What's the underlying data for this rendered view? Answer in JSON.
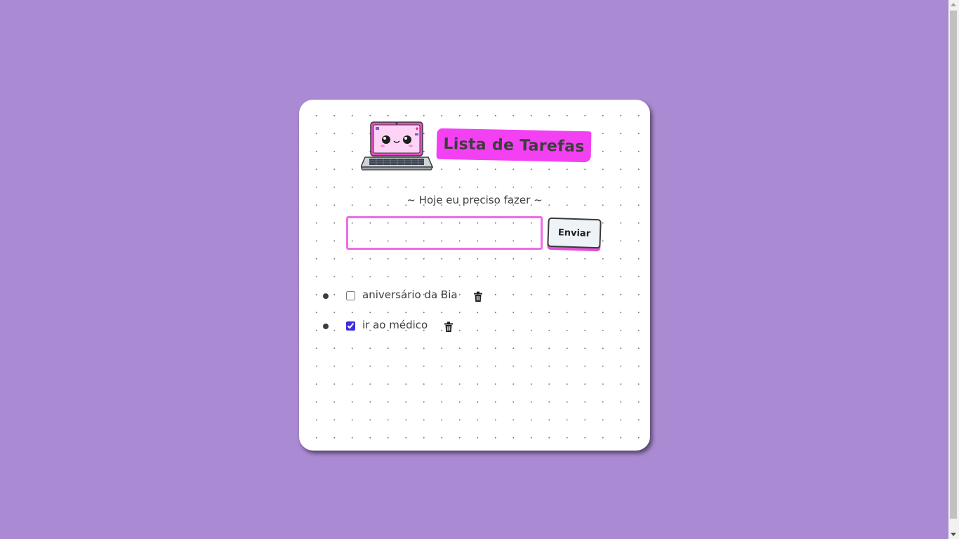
{
  "app": {
    "title": "Lista de Tarefas",
    "subtitle": "~ Hoje eu preciso fazer ~"
  },
  "form": {
    "input_value": "",
    "input_placeholder": "",
    "send_label": "Enviar"
  },
  "tasks": [
    {
      "label": "aniversário da Bia",
      "checked": false
    },
    {
      "label": "ir ao médico",
      "checked": true
    }
  ],
  "icons": {
    "logo": "laptop-icon",
    "delete": "trash-icon"
  },
  "colors": {
    "background": "#aa8ad2",
    "accent": "#f340f2",
    "input_border": "#f06ce7",
    "card": "#ffffff"
  }
}
